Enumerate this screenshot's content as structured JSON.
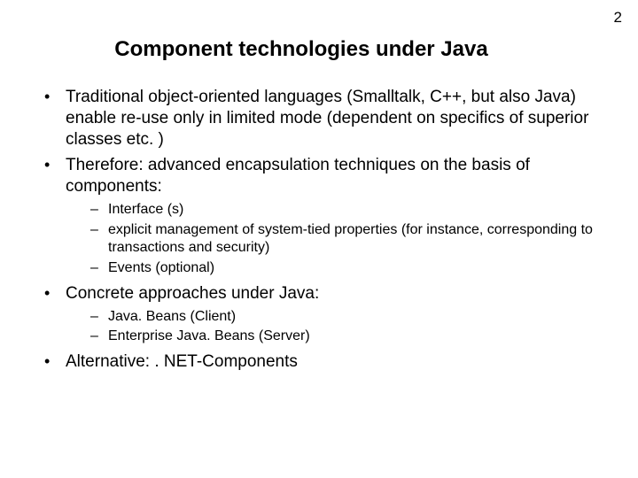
{
  "page_number": "2",
  "title": "Component technologies under Java",
  "bullets": [
    {
      "text": "Traditional object-oriented languages (Smalltalk, C++, but also Java) enable re-use only in limited mode (dependent on specifics of superior classes etc. )"
    },
    {
      "text": "Therefore: advanced encapsulation techniques on the basis of components:",
      "sub": [
        "Interface (s)",
        "explicit management of system-tied properties (for instance, corresponding to transactions and security)",
        "Events (optional)"
      ]
    },
    {
      "text": "Concrete approaches under Java:",
      "sub": [
        "Java. Beans (Client)",
        "Enterprise Java. Beans (Server)"
      ]
    },
    {
      "text": "Alternative: . NET-Components"
    }
  ]
}
